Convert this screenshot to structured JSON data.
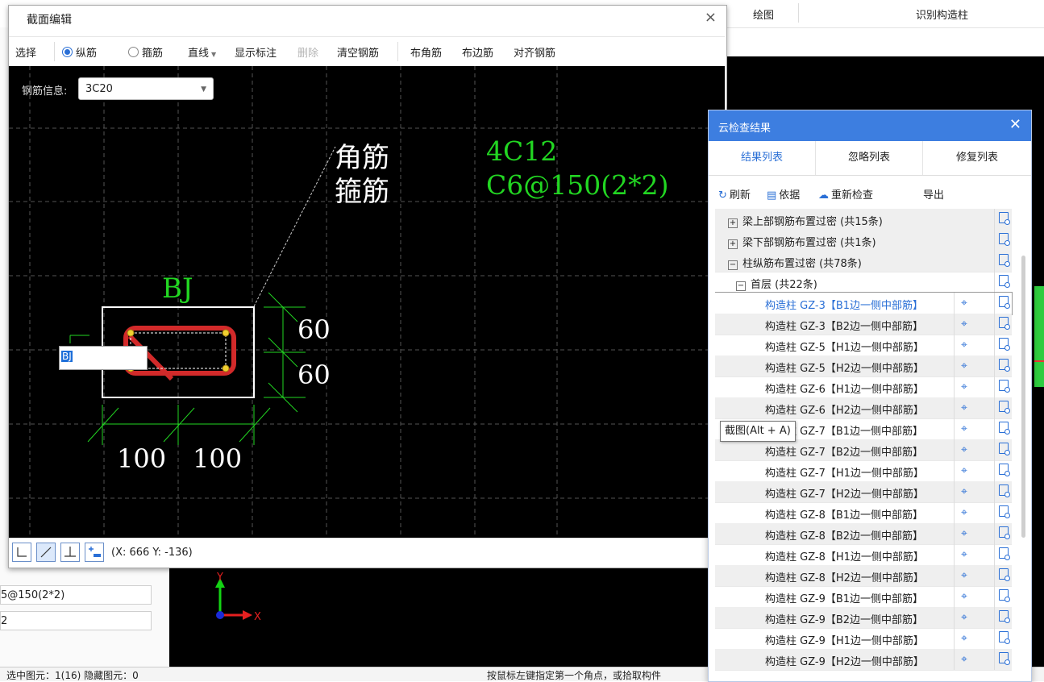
{
  "app": {
    "menu": {
      "draw": "绘图",
      "identify": "识别构造柱"
    },
    "left_fields": [
      "5@150(2*2)",
      "2"
    ],
    "status_left": "选中图元：1(16)    隐藏图元：0",
    "status_right": "按鼠标左键指定第一个角点，或拾取构件"
  },
  "dialog": {
    "title": "截面编辑",
    "close": "×",
    "toolbar": {
      "select": "选择",
      "longitudinal": "纵筋",
      "stirrup": "箍筋",
      "line_mode": "直线",
      "show_annotation": "显示标注",
      "delete": "删除",
      "clear_rebar": "清空钢筋",
      "corner_rebar": "布角筋",
      "edge_rebar": "布边筋",
      "align_rebar": "对齐钢筋"
    },
    "rebar_info_label": "钢筋信息:",
    "rebar_info_value": "3C20",
    "canvas": {
      "label_corner": "角筋",
      "label_stirrup": "箍筋",
      "value_corner": "4C12",
      "value_stirrup": "C6@150(2*2)",
      "section_name": "BJ",
      "dim_v1": "60",
      "dim_v2": "60",
      "dim_h1": "100",
      "dim_h2": "100",
      "input_value": "BJ"
    },
    "coords": "(X: 666 Y: -136)"
  },
  "axis": {
    "y": "Y",
    "x": "X"
  },
  "panel": {
    "title": "云检查结果",
    "tabs": [
      "结果列表",
      "忽略列表",
      "修复列表"
    ],
    "actions": {
      "refresh": "刷新",
      "basis": "依据",
      "recheck": "重新检查",
      "export": "导出"
    },
    "groups": [
      {
        "label": "梁上部钢筋布置过密 (共15条)",
        "toggle": "+"
      },
      {
        "label": "梁下部钢筋布置过密 (共1条)",
        "toggle": "+"
      },
      {
        "label": "柱纵筋布置过密 (共78条)",
        "toggle": "−"
      }
    ],
    "floor": {
      "label": "首层 (共22条)",
      "toggle": "−"
    },
    "items": [
      "构造柱 GZ-3【B1边一侧中部筋】",
      "构造柱 GZ-3【B2边一侧中部筋】",
      "构造柱 GZ-5【H1边一侧中部筋】",
      "构造柱 GZ-5【H2边一侧中部筋】",
      "构造柱 GZ-6【H1边一侧中部筋】",
      "构造柱 GZ-6【H2边一侧中部筋】",
      "构造柱 GZ-7【B1边一侧中部筋】",
      "构造柱 GZ-7【B2边一侧中部筋】",
      "构造柱 GZ-7【H1边一侧中部筋】",
      "构造柱 GZ-7【H2边一侧中部筋】",
      "构造柱 GZ-8【B1边一侧中部筋】",
      "构造柱 GZ-8【B2边一侧中部筋】",
      "构造柱 GZ-8【H1边一侧中部筋】",
      "构造柱 GZ-8【H2边一侧中部筋】",
      "构造柱 GZ-9【B1边一侧中部筋】",
      "构造柱 GZ-9【B2边一侧中部筋】",
      "构造柱 GZ-9【H1边一侧中部筋】",
      "构造柱 GZ-9【H2边一侧中部筋】"
    ],
    "tooltip": "截图(Alt + A)"
  }
}
